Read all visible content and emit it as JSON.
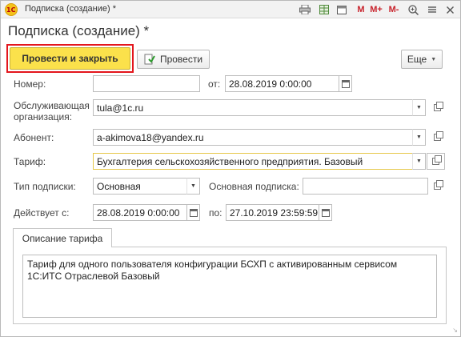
{
  "window": {
    "title": "Подписка (создание) *",
    "logo_text": "1С"
  },
  "toolbar_icons": {
    "m": "M",
    "m_plus": "M+",
    "m_minus": "M-",
    "zoom": "+"
  },
  "form": {
    "heading": "Подписка (создание) *",
    "buttons": {
      "post_and_close": "Провести и закрыть",
      "post": "Провести",
      "more": "Еще"
    },
    "number": {
      "label": "Номер:",
      "value": ""
    },
    "date": {
      "label": "от:",
      "value": "28.08.2019  0:00:00"
    },
    "organization": {
      "label": "Обслуживающая организация:",
      "value": "tula@1c.ru"
    },
    "subscriber": {
      "label": "Абонент:",
      "value": "a-akimova18@yandex.ru"
    },
    "tariff": {
      "label": "Тариф:",
      "value": "Бухгалтерия сельскохозяйственного предприятия. Базовый"
    },
    "subscription_type": {
      "label": "Тип подписки:",
      "value": "Основная"
    },
    "main_subscription": {
      "label": "Основная подписка:",
      "value": ""
    },
    "valid_from": {
      "label": "Действует с:",
      "value": "28.08.2019  0:00:00"
    },
    "valid_to": {
      "label": "по:",
      "value": "27.10.2019 23:59:59"
    },
    "tabs": [
      {
        "label": "Описание тарифа"
      }
    ],
    "description": "Тариф для одного пользователя конфигурации БСХП с активированным сервисом 1С:ИТС Отраслевой Базовый"
  },
  "colors": {
    "primary_button": "#fbe14b",
    "primary_outline": "#e3161d",
    "focused_field_border": "#e6c84a"
  }
}
